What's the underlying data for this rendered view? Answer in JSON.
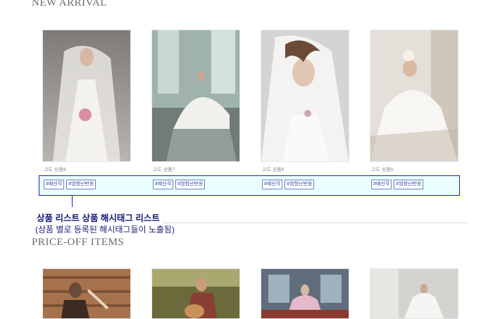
{
  "sections": {
    "new_arrival_title": "NEW ARRIVAL",
    "price_off_title": "PRICE-OFF ITEMS"
  },
  "new_arrival": [
    {
      "name": "고도 상품8",
      "tags": [
        "#예신각",
        "#엄청난반응"
      ]
    },
    {
      "name": "고도 상품7",
      "tags": [
        "#예신각",
        "#엄청난반응"
      ]
    },
    {
      "name": "고도 상품6",
      "tags": [
        "#예신각",
        "#엄청난반응"
      ]
    },
    {
      "name": "고도 상품5",
      "tags": [
        "#예신각",
        "#엄청난반응"
      ]
    }
  ],
  "annotation": {
    "title": "상품 리스트 상품 해시태그 리스트",
    "subtitle": "(상품 별로 등록된 해시태그들이 노출됨)"
  },
  "colors": {
    "highlight_border": "#1b1bd1",
    "highlight_fill": "#eaffff"
  }
}
